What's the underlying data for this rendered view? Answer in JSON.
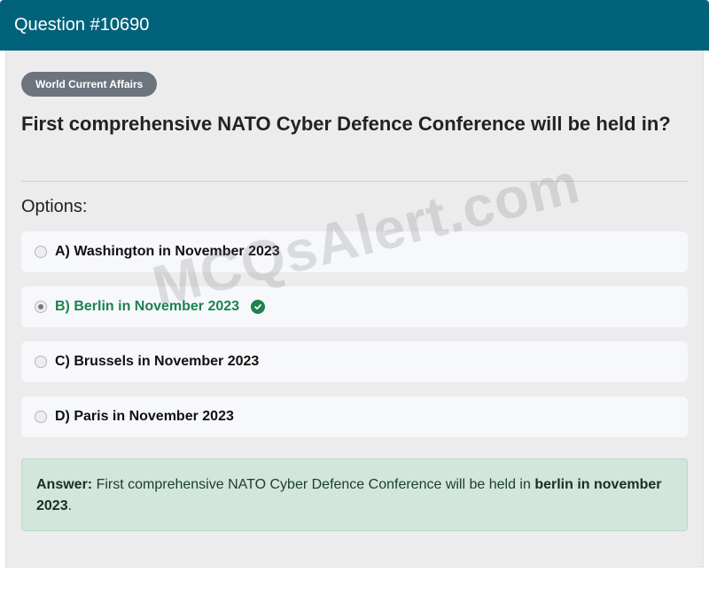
{
  "header": {
    "title": "Question #10690"
  },
  "category": {
    "label": "World Current Affairs"
  },
  "question": {
    "text": "First comprehensive NATO Cyber Defence Conference will be held in?"
  },
  "options_heading": "Options:",
  "options": [
    {
      "label": "A) Washington in November 2023",
      "selected": false,
      "correct": false
    },
    {
      "label": "B) Berlin in November 2023",
      "selected": true,
      "correct": true
    },
    {
      "label": "C) Brussels in November 2023",
      "selected": false,
      "correct": false
    },
    {
      "label": "D) Paris in November 2023",
      "selected": false,
      "correct": false
    }
  ],
  "answer": {
    "prefix": "Answer:",
    "text": "First comprehensive NATO Cyber Defence Conference will be held in",
    "highlight": "berlin in november 2023",
    "suffix": "."
  },
  "watermark": "MCQsAlert.com",
  "colors": {
    "header": "#02627a",
    "correct": "#1e8250",
    "answer_bg": "#d2e6dc",
    "badge": "#6c757d"
  }
}
